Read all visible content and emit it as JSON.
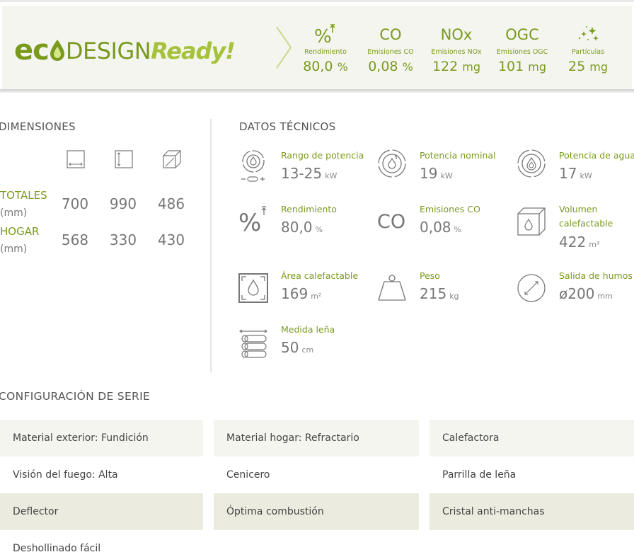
{
  "brand": {
    "logo_eco_prefix": "ec",
    "logo_design": "DESIGN",
    "logo_ready": "Ready!",
    "accent_color": "#7a9a1e",
    "accent_light": "#a6c23a"
  },
  "eco_metrics": [
    {
      "symbol": "%",
      "icon": "percent-arrow-up-icon",
      "label": "Rendimiento",
      "value": "80,0",
      "unit": "%"
    },
    {
      "symbol": "CO",
      "icon": "",
      "label": "Emisiones CO",
      "value": "0,08",
      "unit": "%"
    },
    {
      "symbol": "NOx",
      "icon": "",
      "label": "Emisiones NOx",
      "value": "122",
      "unit": "mg"
    },
    {
      "symbol": "OGC",
      "icon": "",
      "label": "Emisiones OGC",
      "value": "101",
      "unit": "mg"
    },
    {
      "symbol": "",
      "icon": "sparkles-icon",
      "label": "Partículas",
      "value": "25",
      "unit": "mg"
    }
  ],
  "dimensions": {
    "title": "DIMENSIONES",
    "icons": [
      "width-icon",
      "height-icon",
      "depth-icon"
    ],
    "rows": [
      {
        "label": "TOTALES",
        "unit": "(mm)",
        "values": [
          "700",
          "990",
          "486"
        ]
      },
      {
        "label": "HOGAR",
        "unit": "(mm)",
        "values": [
          "568",
          "330",
          "430"
        ]
      }
    ]
  },
  "technical": {
    "title": "DATOS TÉCNICOS",
    "items": [
      {
        "label": "Rango de potencia",
        "value": "13-25",
        "unit": "kW",
        "icon": "power-range-icon"
      },
      {
        "label": "Potencia nominal",
        "value": "19",
        "unit": "kW",
        "icon": "nominal-power-icon"
      },
      {
        "label": "Potencia de agua",
        "value": "17",
        "unit": "kW",
        "icon": "water-power-icon"
      },
      {
        "label": "Rendimiento",
        "value": "80,0",
        "unit": "%",
        "icon": "efficiency-icon"
      },
      {
        "label": "Emisiones CO",
        "value": "0,08",
        "unit": "%",
        "icon": "co-emissions-icon",
        "symbol": "CO"
      },
      {
        "label": "Volumen calefactable",
        "value": "422",
        "unit": "m³",
        "icon": "heatable-volume-icon"
      },
      {
        "label": "Área calefactable",
        "value": "169",
        "unit": "m²",
        "icon": "heatable-area-icon"
      },
      {
        "label": "Peso",
        "value": "215",
        "unit": "kg",
        "icon": "weight-icon"
      },
      {
        "label": "Salida de humos",
        "value": "ø200",
        "unit": "mm",
        "icon": "smoke-outlet-icon"
      },
      {
        "label": "Medida leña",
        "value": "50",
        "unit": "cm",
        "icon": "firewood-icon"
      }
    ]
  },
  "configuration": {
    "title": "CONFIGURACIÓN DE SERIE",
    "rows": [
      [
        "Material exterior: Fundición",
        "Material hogar: Refractario",
        "Calefactora"
      ],
      [
        "Visión del fuego: Alta",
        "Cenicero",
        "Parrilla de leña"
      ],
      [
        "Deflector",
        "Óptima combustión",
        "Cristal anti-manchas"
      ],
      [
        "Deshollinado fácil",
        "",
        ""
      ]
    ]
  }
}
